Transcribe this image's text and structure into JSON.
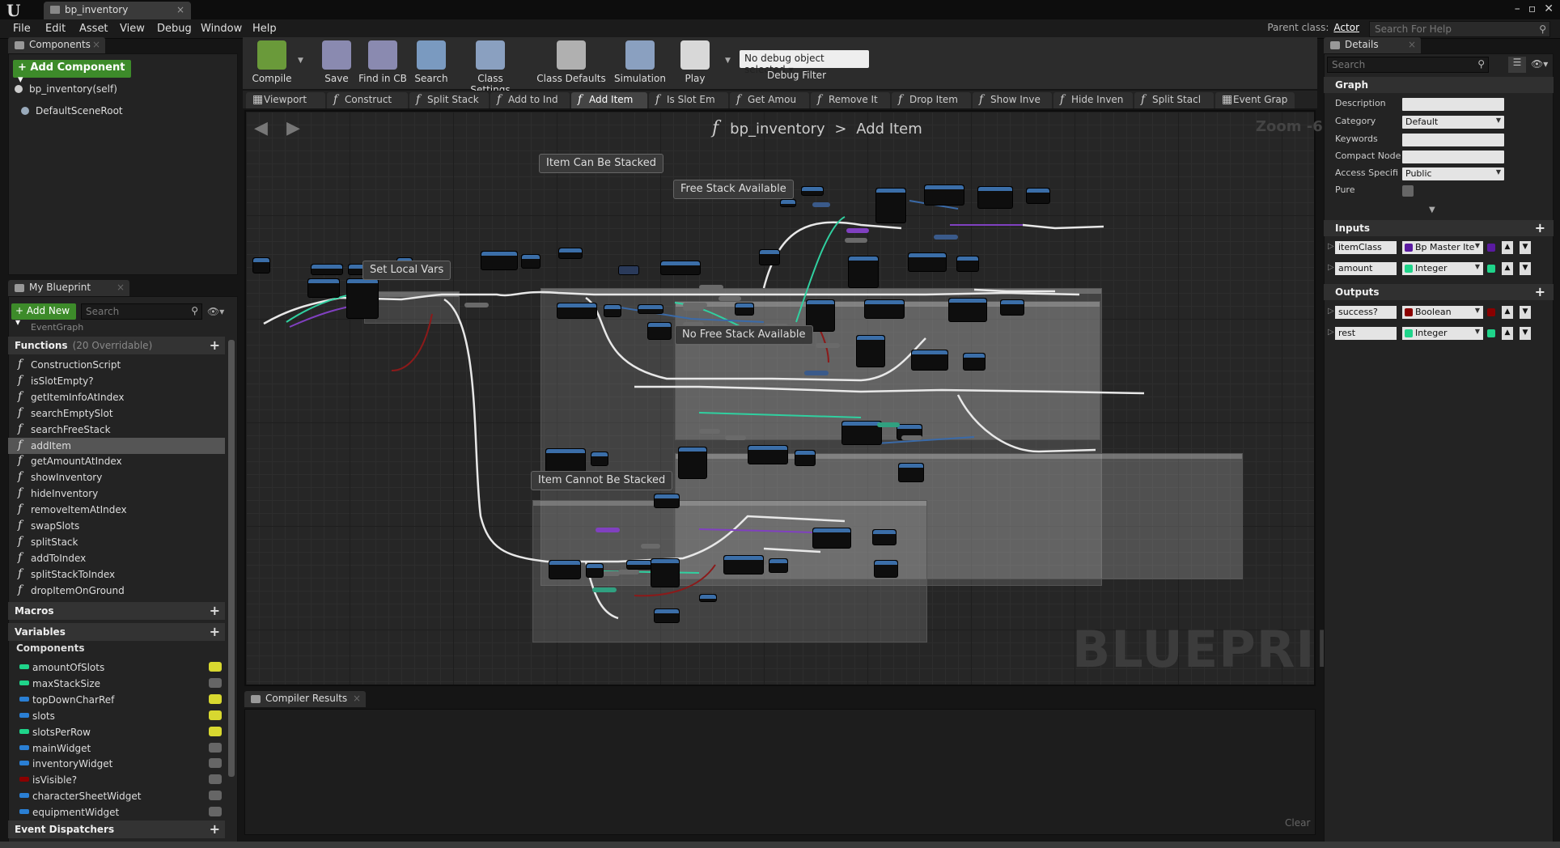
{
  "window": {
    "tab": "bp_inventory"
  },
  "menu": [
    "File",
    "Edit",
    "Asset",
    "View",
    "Debug",
    "Window",
    "Help"
  ],
  "parent_class": {
    "label": "Parent class:",
    "value": "Actor"
  },
  "help_search": {
    "placeholder": "Search For Help"
  },
  "components": {
    "tab": "Components",
    "add_button": "+ Add Component ▾",
    "items": [
      "bp_inventory(self)",
      "DefaultSceneRoot"
    ]
  },
  "my_blueprint": {
    "tab": "My Blueprint",
    "add_new": "+ Add New ▾",
    "search_placeholder": "Search",
    "event_graph": "EventGraph",
    "functions_header": "Functions",
    "functions_sub": "(20 Overridable)",
    "functions": [
      "ConstructionScript",
      "isSlotEmpty?",
      "getItemInfoAtIndex",
      "searchEmptySlot",
      "searchFreeStack",
      "addItem",
      "getAmountAtIndex",
      "showInventory",
      "hideInventory",
      "removeItemAtIndex",
      "swapSlots",
      "splitStack",
      "addToIndex",
      "splitStackToIndex",
      "dropItemOnGround"
    ],
    "selected_function": "addItem",
    "macros_header": "Macros",
    "variables_header": "Variables",
    "components_header": "Components",
    "variables": [
      {
        "name": "amountOfSlots",
        "color": "#1fd48a",
        "visible": true
      },
      {
        "name": "maxStackSize",
        "color": "#1fd48a",
        "visible": false
      },
      {
        "name": "topDownCharRef",
        "color": "#2a7fd4",
        "visible": true
      },
      {
        "name": "slots",
        "color": "#2a7fd4",
        "visible": true
      },
      {
        "name": "slotsPerRow",
        "color": "#1fd48a",
        "visible": true
      },
      {
        "name": "mainWidget",
        "color": "#2a7fd4",
        "visible": false
      },
      {
        "name": "inventoryWidget",
        "color": "#2a7fd4",
        "visible": false
      },
      {
        "name": "isVisible?",
        "color": "#8b0000",
        "visible": false
      },
      {
        "name": "characterSheetWidget",
        "color": "#2a7fd4",
        "visible": false
      },
      {
        "name": "equipmentWidget",
        "color": "#2a7fd4",
        "visible": false
      }
    ],
    "dispatchers_header": "Event Dispatchers"
  },
  "toolbar": {
    "buttons": [
      {
        "label": "Compile",
        "icon": "compile-icon",
        "color": "#6a9a3a"
      },
      {
        "label": "Save",
        "icon": "save-icon",
        "color": "#8a8ab0"
      },
      {
        "label": "Find in CB",
        "icon": "find-icon",
        "color": "#8a8ab0"
      },
      {
        "label": "Search",
        "icon": "search-icon",
        "color": "#7a9ac0"
      },
      {
        "label": "Class Settings",
        "icon": "gear-icon",
        "color": "#8aa0c0"
      },
      {
        "label": "Class Defaults",
        "icon": "defaults-icon",
        "color": "#b0b0b0"
      },
      {
        "label": "Simulation",
        "icon": "simulation-icon",
        "color": "#8aa0c0"
      },
      {
        "label": "Play",
        "icon": "play-icon",
        "color": "#d8d8d8"
      }
    ],
    "debug_select": "No debug object selected ▾",
    "debug_filter": "Debug Filter"
  },
  "graph_tabs": [
    {
      "label": "Viewport",
      "icon": "viewport"
    },
    {
      "label": "Construct",
      "icon": "f"
    },
    {
      "label": "Split Stack",
      "icon": "f"
    },
    {
      "label": "Add to Ind",
      "icon": "f"
    },
    {
      "label": "Add Item",
      "icon": "f"
    },
    {
      "label": "Is Slot Em",
      "icon": "f"
    },
    {
      "label": "Get Amou",
      "icon": "f"
    },
    {
      "label": "Remove It",
      "icon": "f"
    },
    {
      "label": "Drop Item",
      "icon": "f"
    },
    {
      "label": "Show Inve",
      "icon": "f"
    },
    {
      "label": "Hide Inven",
      "icon": "f"
    },
    {
      "label": "Split Stacl",
      "icon": "f"
    },
    {
      "label": "Event Grap",
      "icon": "graph"
    }
  ],
  "active_graph_tab": "Add Item",
  "breadcrumb": {
    "bp": "bp_inventory",
    "sep": ">",
    "fn": "Add Item"
  },
  "zoom": "Zoom -6",
  "watermark": "BLUEPRINT",
  "comments": [
    "Item Can Be Stacked",
    "Free Stack Available",
    "No Free Stack Available",
    "Set Local Vars",
    "Item Cannot Be Stacked"
  ],
  "compiler": {
    "tab": "Compiler Results",
    "clear": "Clear"
  },
  "details": {
    "tab": "Details",
    "search_placeholder": "Search",
    "graph_header": "Graph",
    "fields": [
      {
        "label": "Description",
        "value": ""
      },
      {
        "label": "Category",
        "value": "Default"
      },
      {
        "label": "Keywords",
        "value": ""
      },
      {
        "label": "Compact Node",
        "value": ""
      },
      {
        "label": "Access Specifi",
        "value": "Public"
      },
      {
        "label": "Pure",
        "value": ""
      }
    ],
    "inputs_header": "Inputs",
    "inputs": [
      {
        "name": "itemClass",
        "type": "Bp Master Ite",
        "color": "#5a1aa0"
      },
      {
        "name": "amount",
        "type": "Integer",
        "color": "#1fd48a"
      }
    ],
    "outputs_header": "Outputs",
    "outputs": [
      {
        "name": "success?",
        "type": "Boolean",
        "color": "#8b0000"
      },
      {
        "name": "rest",
        "type": "Integer",
        "color": "#1fd48a"
      }
    ]
  }
}
